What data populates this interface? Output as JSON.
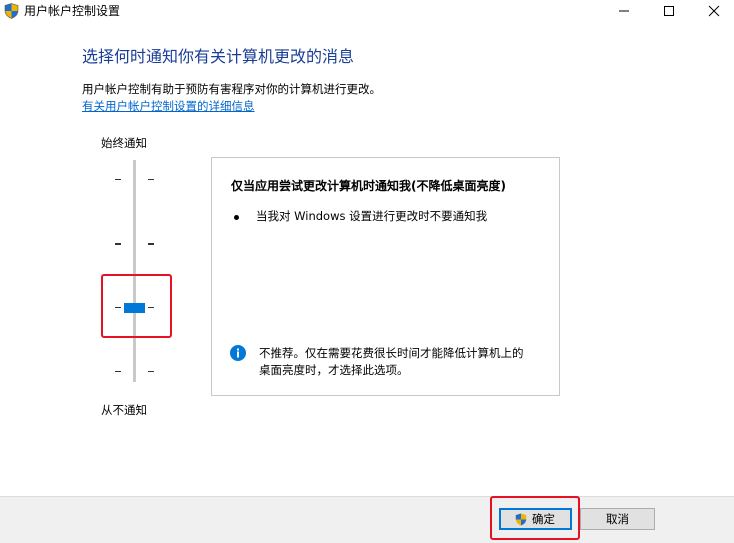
{
  "window": {
    "title": "用户帐户控制设置",
    "app_icon": "uac-shield-icon",
    "controls": [
      "minimize-icon",
      "maximize-icon",
      "close-icon"
    ]
  },
  "main": {
    "heading": "选择何时通知你有关计算机更改的消息",
    "description": "用户帐户控制有助于预防有害程序对你的计算机进行更改。",
    "link": "有关用户帐户控制设置的详细信息"
  },
  "slider": {
    "top_label": "始终通知",
    "bottom_label": "从不通知",
    "levels": 4,
    "selected_level": 2
  },
  "panel": {
    "title": "仅当应用尝试更改计算机时通知我(不降低桌面亮度)",
    "bullet": "当我对 Windows 设置进行更改时不要通知我",
    "note_icon": "info-icon",
    "note_line1": "不推荐。仅在需要花费很长时间才能降低计算机上的",
    "note_line2": "桌面亮度时，才选择此选项。"
  },
  "buttons": {
    "ok": "确定",
    "cancel": "取消",
    "ok_icon": "uac-shield-icon"
  },
  "colors": {
    "heading": "#1a3e96",
    "link": "#0066cc",
    "accent": "#0078d7",
    "highlight": "#e81123"
  }
}
